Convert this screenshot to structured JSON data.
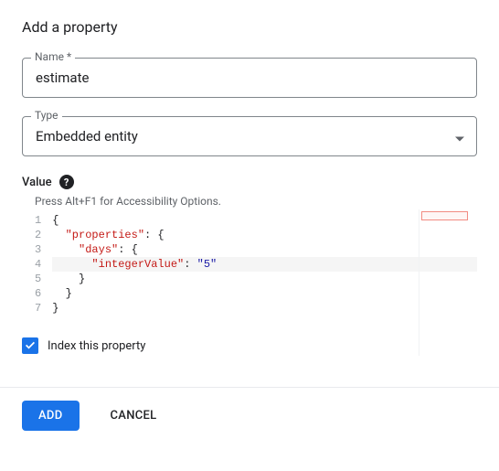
{
  "dialog": {
    "title": "Add a property"
  },
  "fields": {
    "name_label": "Name *",
    "name_value": "estimate",
    "type_label": "Type",
    "type_value": "Embedded entity",
    "value_label": "Value",
    "accessibility_hint": "Press Alt+F1 for Accessibility Options."
  },
  "code": {
    "lines": [
      {
        "n": "1",
        "indent": 0,
        "tokens": [
          {
            "t": "punc",
            "v": "{"
          }
        ]
      },
      {
        "n": "2",
        "indent": 1,
        "tokens": [
          {
            "t": "key",
            "v": "\"properties\""
          },
          {
            "t": "punc",
            "v": ": {"
          }
        ]
      },
      {
        "n": "3",
        "indent": 2,
        "tokens": [
          {
            "t": "key",
            "v": "\"days\""
          },
          {
            "t": "punc",
            "v": ": {"
          }
        ]
      },
      {
        "n": "4",
        "indent": 3,
        "highlight": true,
        "tokens": [
          {
            "t": "key",
            "v": "\"integerValue\""
          },
          {
            "t": "punc",
            "v": ": "
          },
          {
            "t": "str",
            "v": "\"5\""
          }
        ]
      },
      {
        "n": "5",
        "indent": 2,
        "tokens": [
          {
            "t": "punc",
            "v": "}"
          }
        ]
      },
      {
        "n": "6",
        "indent": 1,
        "tokens": [
          {
            "t": "punc",
            "v": "}"
          }
        ]
      },
      {
        "n": "7",
        "indent": 0,
        "tokens": [
          {
            "t": "punc",
            "v": "}"
          }
        ]
      }
    ]
  },
  "checkbox": {
    "label": "Index this property",
    "checked": true
  },
  "actions": {
    "add": "ADD",
    "cancel": "CANCEL"
  },
  "colors": {
    "primary": "#1a73e8"
  }
}
